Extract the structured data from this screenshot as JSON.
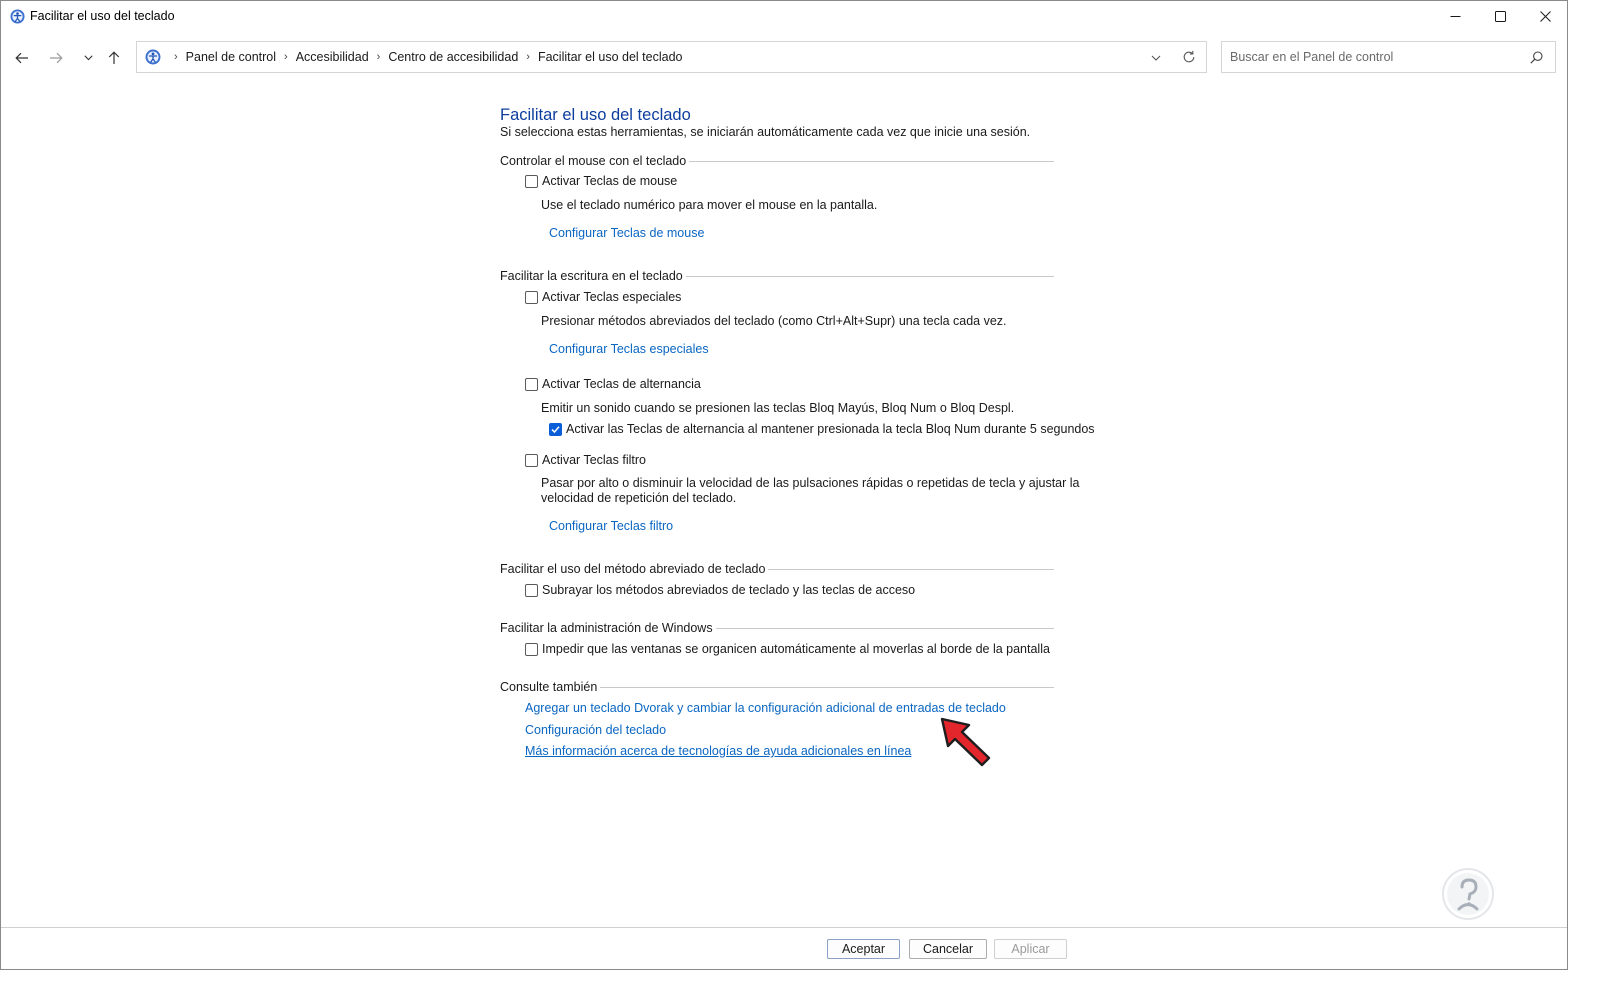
{
  "window": {
    "title": "Facilitar el uso del teclado"
  },
  "address_bar": {
    "crumbs": [
      "Panel de control",
      "Accesibilidad",
      "Centro de accesibilidad",
      "Facilitar el uso del teclado"
    ]
  },
  "search": {
    "placeholder": "Buscar en el Panel de control"
  },
  "page": {
    "title": "Facilitar el uso del teclado",
    "subtitle": "Si selecciona estas herramientas, se iniciarán automáticamente cada vez que inicie una sesión."
  },
  "sections": {
    "mouse": {
      "heading": "Controlar el mouse con el teclado",
      "checkbox_label": "Activar Teclas de mouse",
      "checked": false,
      "description": "Use el teclado numérico para mover el mouse en la pantalla.",
      "link": "Configurar Teclas de mouse"
    },
    "typing": {
      "heading": "Facilitar la escritura en el teclado",
      "sticky_label": "Activar Teclas especiales",
      "sticky_checked": false,
      "sticky_description": "Presionar métodos abreviados del teclado (como Ctrl+Alt+Supr) una tecla cada vez.",
      "sticky_link": "Configurar Teclas especiales",
      "toggle_label": "Activar Teclas de alternancia",
      "toggle_checked": false,
      "toggle_description": "Emitir un sonido cuando se presionen las teclas Bloq Mayús, Bloq Num o Bloq Despl.",
      "toggle_sub_label": "Activar las Teclas de alternancia al mantener presionada la tecla Bloq Num durante 5 segundos",
      "toggle_sub_checked": true,
      "filter_label": "Activar Teclas filtro",
      "filter_checked": false,
      "filter_description_line1": "Pasar por alto o disminuir la velocidad de las pulsaciones rápidas o repetidas de tecla y ajustar la",
      "filter_description_line2": "velocidad de repetición del teclado.",
      "filter_link": "Configurar Teclas filtro"
    },
    "shortcuts": {
      "heading": "Facilitar el uso del método abreviado de teclado",
      "checkbox_label": "Subrayar los métodos abreviados de teclado y las teclas de acceso",
      "checked": false
    },
    "windows": {
      "heading": "Facilitar la administración de Windows",
      "checkbox_label": "Impedir que las ventanas se organicen automáticamente al moverlas al borde de la pantalla",
      "checked": false
    },
    "see_also": {
      "heading": "Consulte también",
      "links": [
        "Agregar un teclado Dvorak y cambiar la configuración adicional de entradas de teclado",
        "Configuración del teclado",
        "Más información acerca de tecnologías de ayuda adicionales en línea"
      ]
    }
  },
  "buttons": {
    "ok": "Aceptar",
    "cancel": "Cancelar",
    "apply": "Aplicar"
  },
  "colors": {
    "title_blue": "#0d3e9e",
    "link_blue": "#0a66c2",
    "checkbox_checked": "#0a5ed7",
    "arrow_red": "#e3262b"
  },
  "icons": {
    "app": "control-panel-icon",
    "back": "arrow-left-icon",
    "forward": "arrow-right-icon",
    "recent": "chevron-down-icon",
    "up": "arrow-up-icon",
    "refresh": "refresh-icon",
    "search": "search-icon",
    "overlay_arrow": "red-pointer-arrow-icon",
    "watermark": "person-question-logo"
  }
}
